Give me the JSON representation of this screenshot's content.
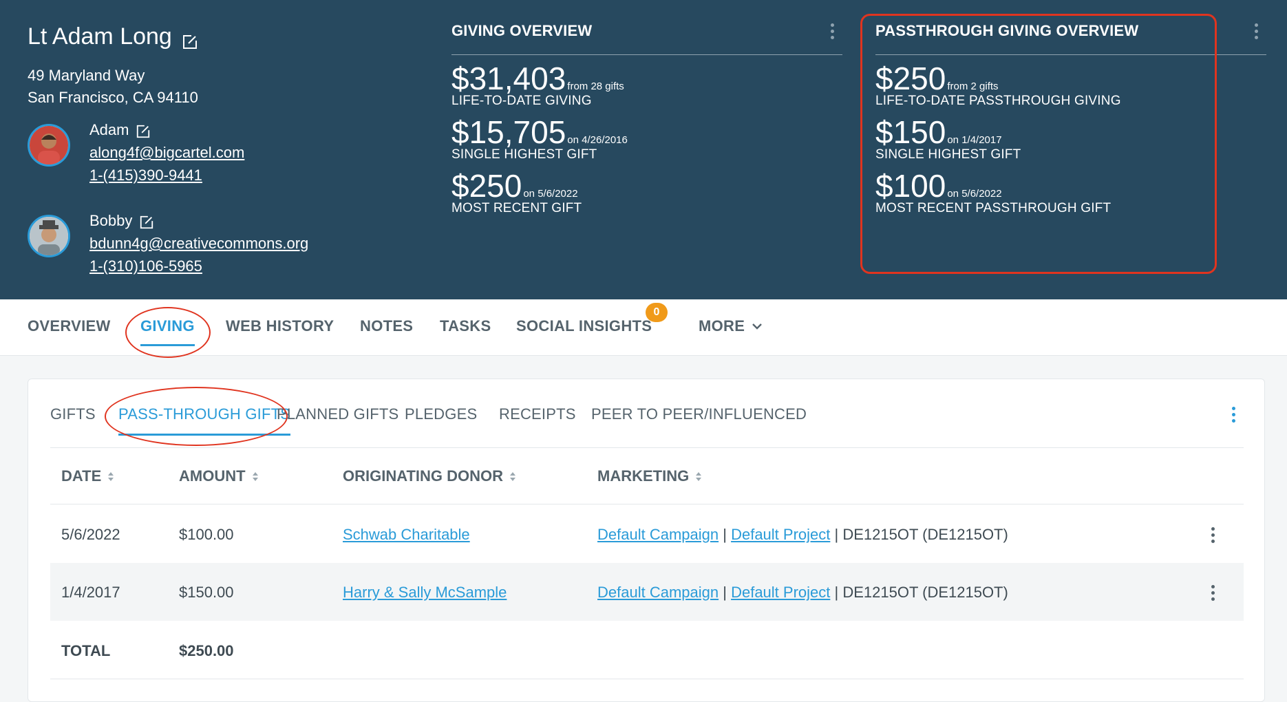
{
  "profile": {
    "name": "Lt Adam Long",
    "address_line1": "49 Maryland Way",
    "address_line2": "San Francisco, CA 94110",
    "contacts": [
      {
        "name": "Adam",
        "email": "along4f@bigcartel.com",
        "phone": "1-(415)390-9441"
      },
      {
        "name": "Bobby",
        "email": "bdunn4g@creativecommons.org",
        "phone": "1-(310)106-5965"
      }
    ]
  },
  "giving_overview": {
    "title": "GIVING OVERVIEW",
    "stats": [
      {
        "amount": "$31,403",
        "note": "from 28 gifts",
        "label": "LIFE-TO-DATE GIVING"
      },
      {
        "amount": "$15,705",
        "note": "on 4/26/2016",
        "label": "SINGLE HIGHEST GIFT"
      },
      {
        "amount": "$250",
        "note": "on 5/6/2022",
        "label": "MOST RECENT GIFT"
      }
    ]
  },
  "passthrough_overview": {
    "title": "PASSTHROUGH GIVING OVERVIEW",
    "stats": [
      {
        "amount": "$250",
        "note": "from 2 gifts",
        "label": "LIFE-TO-DATE PASSTHROUGH GIVING"
      },
      {
        "amount": "$150",
        "note": "on 1/4/2017",
        "label": "SINGLE HIGHEST GIFT"
      },
      {
        "amount": "$100",
        "note": "on 5/6/2022",
        "label": "MOST RECENT PASSTHROUGH GIFT"
      }
    ]
  },
  "main_tabs": [
    "OVERVIEW",
    "GIVING",
    "WEB HISTORY",
    "NOTES",
    "TASKS",
    "SOCIAL INSIGHTS",
    "MORE"
  ],
  "social_insights_badge": "0",
  "sub_tabs": [
    "GIFTS",
    "PASS-THROUGH GIFTS",
    "PLANNED GIFTS",
    "PLEDGES",
    "RECEIPTS",
    "PEER TO PEER/INFLUENCED"
  ],
  "table": {
    "headers": [
      "DATE",
      "AMOUNT",
      "ORIGINATING DONOR",
      "MARKETING"
    ],
    "rows": [
      {
        "date": "5/6/2022",
        "amount": "$100.00",
        "donor": "Schwab Charitable",
        "campaign": "Default Campaign",
        "project": "Default Project",
        "code": "DE1215OT (DE1215OT)"
      },
      {
        "date": "1/4/2017",
        "amount": "$150.00",
        "donor": "Harry & Sally McSample",
        "campaign": "Default Campaign",
        "project": "Default Project",
        "code": "DE1215OT (DE1215OT)"
      }
    ],
    "total_label": "TOTAL",
    "total_amount": "$250.00",
    "separator": "|"
  },
  "colors": {
    "header_bg": "#27495f",
    "accent": "#2a9bd8",
    "annotation_red": "#e0341f",
    "badge": "#f09a1a"
  }
}
